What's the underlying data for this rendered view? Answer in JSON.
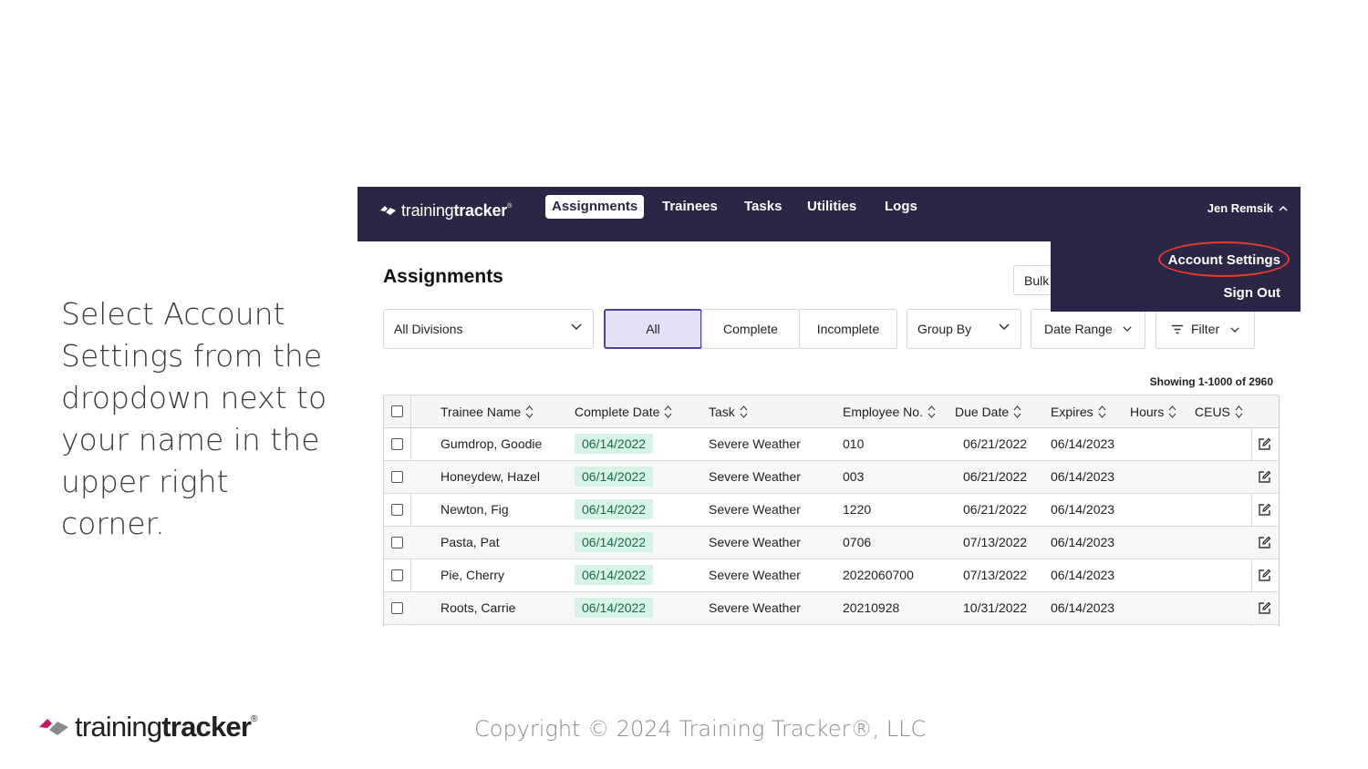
{
  "instruction": {
    "text": "Select Account Settings from the dropdown next to your name in the upper right corner."
  },
  "app": {
    "logo": {
      "light": "training",
      "bold": "tracker",
      "mark": "®"
    },
    "nav_tabs": [
      "Assignments",
      "Trainees",
      "Tasks",
      "Utilities",
      "Logs"
    ],
    "active_tab": "Assignments",
    "user_name": "Jen Remsik",
    "user_menu": {
      "account_settings": "Account Settings",
      "sign_out": "Sign Out"
    },
    "page_title": "Assignments",
    "bulk_button": "Bulk",
    "filters": {
      "division": "All Divisions",
      "status_all": "All",
      "status_complete": "Complete",
      "status_incomplete": "Incomplete",
      "group_by": "Group By",
      "date_range": "Date Range",
      "filter": "Filter"
    },
    "showing": "Showing 1-1000 of 2960",
    "table": {
      "columns": [
        "Trainee Name",
        "Complete Date",
        "Task",
        "Employee No.",
        "Due Date",
        "Expires",
        "Hours",
        "CEUS"
      ],
      "rows": [
        {
          "name": "Gumdrop, Goodie",
          "complete_date": "06/14/2022",
          "task": "Severe Weather",
          "employee_no": "010",
          "due_date": "06/21/2022",
          "expires": "06/14/2023"
        },
        {
          "name": "Honeydew, Hazel",
          "complete_date": "06/14/2022",
          "task": "Severe Weather",
          "employee_no": "003",
          "due_date": "06/21/2022",
          "expires": "06/14/2023"
        },
        {
          "name": "Newton, Fig",
          "complete_date": "06/14/2022",
          "task": "Severe Weather",
          "employee_no": "1220",
          "due_date": "06/21/2022",
          "expires": "06/14/2023"
        },
        {
          "name": "Pasta, Pat",
          "complete_date": "06/14/2022",
          "task": "Severe Weather",
          "employee_no": "0706",
          "due_date": "07/13/2022",
          "expires": "06/14/2023"
        },
        {
          "name": "Pie, Cherry",
          "complete_date": "06/14/2022",
          "task": "Severe Weather",
          "employee_no": "2022060700",
          "due_date": "07/13/2022",
          "expires": "06/14/2023"
        },
        {
          "name": "Roots, Carrie",
          "complete_date": "06/14/2022",
          "task": "Severe Weather",
          "employee_no": "20210928",
          "due_date": "10/31/2022",
          "expires": "06/14/2023"
        }
      ]
    },
    "colors": {
      "nav_bg": "#2b2646",
      "active_seg_bg": "#e4e1f7",
      "badge_bg": "#d7f2e6",
      "highlight": "#e23b2e",
      "logo_accent": "#c2185b"
    }
  },
  "footer": {
    "logo": {
      "light": "training",
      "bold": "tracker",
      "mark": "®"
    },
    "copyright": "Copyright © 2024 Training Tracker®, LLC"
  }
}
